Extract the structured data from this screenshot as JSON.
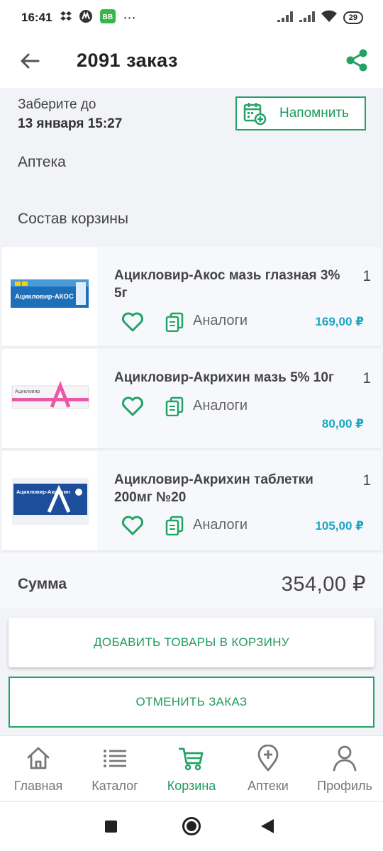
{
  "status_bar": {
    "time": "16:41",
    "battery": "29",
    "app_badge": "BB",
    "more": "⋯"
  },
  "header": {
    "title": "2091 заказ",
    "back_icon": "arrow-left-icon",
    "share_icon": "share-icon"
  },
  "pickup": {
    "label": "Заберите до",
    "date": "13 января 15:27",
    "remind_label": "Напомнить"
  },
  "pharmacy": {
    "label": "Аптека"
  },
  "cart": {
    "title": "Состав корзины",
    "items": [
      {
        "name": "Ацикловир-Акос мазь глазная 3% 5г",
        "qty": "1",
        "analogs_label": "Аналоги",
        "price": "169,00 ₽",
        "pack_text": "Ацикловир-АКОС"
      },
      {
        "name": "Ацикловир-Акрихин мазь 5% 10г",
        "qty": "1",
        "analogs_label": "Аналоги",
        "price": "80,00 ₽",
        "pack_text": "Ацикловир"
      },
      {
        "name": "Ацикловир-Акрихин таблетки 200мг №20",
        "qty": "1",
        "analogs_label": "Аналоги",
        "price": "105,00 ₽",
        "pack_text": "Ацикловир-Акрихин"
      }
    ]
  },
  "summary": {
    "label": "Сумма",
    "value": "354,00 ₽"
  },
  "actions": {
    "add_label": "ДОБАВИТЬ ТОВАРЫ В КОРЗИНУ",
    "cancel_label": "ОТМЕНИТЬ ЗАКАЗ"
  },
  "tabbar": {
    "tabs": [
      {
        "label": "Главная",
        "icon": "home-icon"
      },
      {
        "label": "Каталог",
        "icon": "list-icon"
      },
      {
        "label": "Корзина",
        "icon": "cart-icon",
        "active": true
      },
      {
        "label": "Аптеки",
        "icon": "map-pin-plus-icon"
      },
      {
        "label": "Профиль",
        "icon": "user-icon"
      }
    ]
  },
  "colors": {
    "accent": "#21a366",
    "price": "#1aa6c4",
    "background": "#f2f3f7"
  }
}
